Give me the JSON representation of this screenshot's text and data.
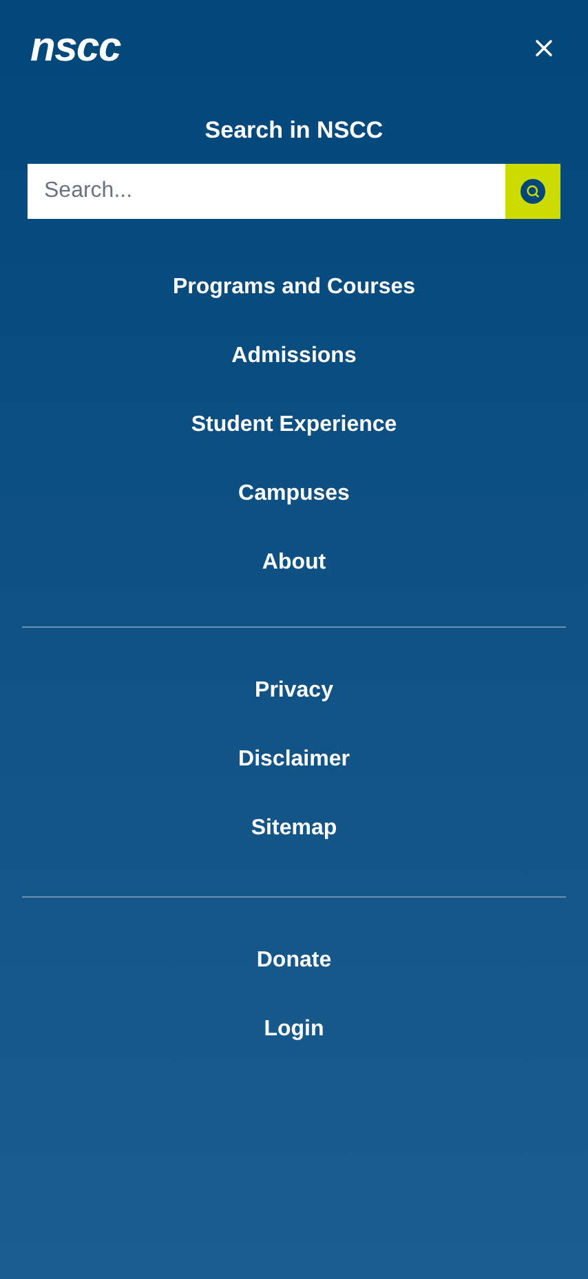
{
  "header": {
    "logo": "nscc"
  },
  "search": {
    "title": "Search in NSCC",
    "placeholder": "Search..."
  },
  "menu_groups": [
    {
      "items": [
        "Programs and Courses",
        "Admissions",
        "Student Experience",
        "Campuses",
        "About"
      ]
    },
    {
      "items": [
        "Privacy",
        "Disclaimer",
        "Sitemap"
      ]
    },
    {
      "items": [
        "Donate",
        "Login"
      ]
    }
  ]
}
